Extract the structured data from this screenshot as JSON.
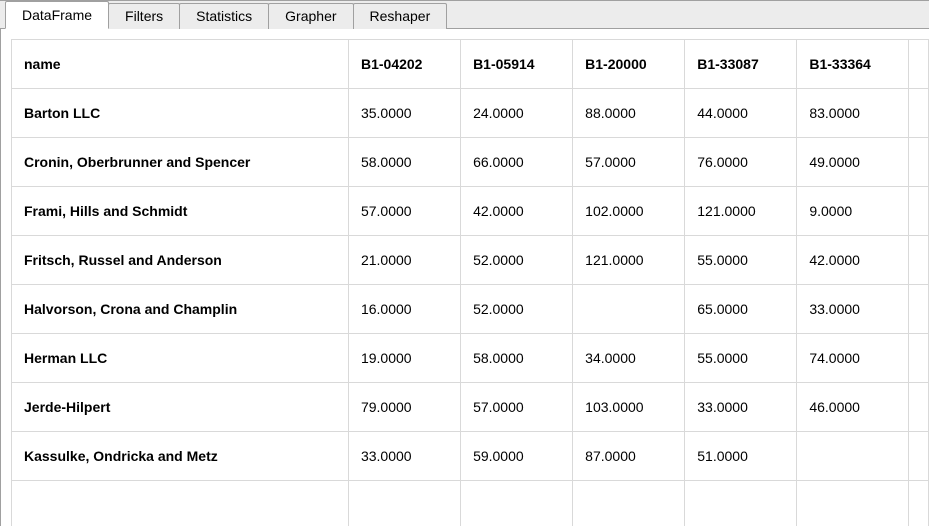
{
  "tabs": [
    {
      "label": "DataFrame",
      "active": true
    },
    {
      "label": "Filters",
      "active": false
    },
    {
      "label": "Statistics",
      "active": false
    },
    {
      "label": "Grapher",
      "active": false
    },
    {
      "label": "Reshaper",
      "active": false
    }
  ],
  "table": {
    "columns": [
      "name",
      "B1-04202",
      "B1-05914",
      "B1-20000",
      "B1-33087",
      "B1-33364"
    ],
    "rows": [
      {
        "name": "Barton LLC",
        "c0": "35.0000",
        "c1": "24.0000",
        "c2": "88.0000",
        "c3": "44.0000",
        "c4": "83.0000"
      },
      {
        "name": "Cronin, Oberbrunner and Spencer",
        "c0": "58.0000",
        "c1": "66.0000",
        "c2": "57.0000",
        "c3": "76.0000",
        "c4": "49.0000"
      },
      {
        "name": "Frami, Hills and Schmidt",
        "c0": "57.0000",
        "c1": "42.0000",
        "c2": "102.0000",
        "c3": "121.0000",
        "c4": "9.0000"
      },
      {
        "name": "Fritsch, Russel and Anderson",
        "c0": "21.0000",
        "c1": "52.0000",
        "c2": "121.0000",
        "c3": "55.0000",
        "c4": "42.0000"
      },
      {
        "name": "Halvorson, Crona and Champlin",
        "c0": "16.0000",
        "c1": "52.0000",
        "c2": "",
        "c3": "65.0000",
        "c4": "33.0000"
      },
      {
        "name": "Herman LLC",
        "c0": "19.0000",
        "c1": "58.0000",
        "c2": "34.0000",
        "c3": "55.0000",
        "c4": "74.0000"
      },
      {
        "name": "Jerde-Hilpert",
        "c0": "79.0000",
        "c1": "57.0000",
        "c2": "103.0000",
        "c3": "33.0000",
        "c4": "46.0000"
      },
      {
        "name": "Kassulke, Ondricka and Metz",
        "c0": "33.0000",
        "c1": "59.0000",
        "c2": "87.0000",
        "c3": "51.0000",
        "c4": ""
      }
    ]
  }
}
